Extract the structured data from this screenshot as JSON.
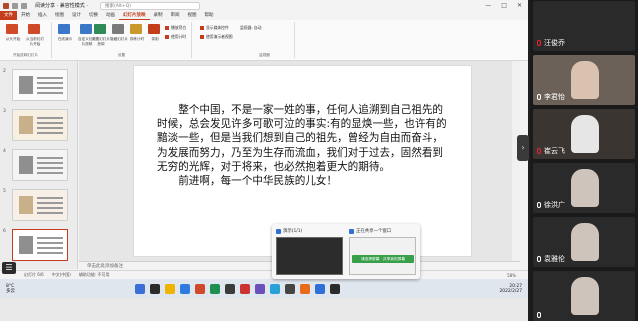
{
  "window": {
    "document_title": "阅读分享 · 兼容性模式 ·",
    "search_placeholder": "搜索(Alt+Q)",
    "window_controls": [
      "—",
      "□",
      "✕"
    ]
  },
  "tabs": [
    {
      "label": "文件",
      "active": false,
      "file": true
    },
    {
      "label": "开始",
      "active": false
    },
    {
      "label": "插入",
      "active": false
    },
    {
      "label": "绘图",
      "active": false
    },
    {
      "label": "设计",
      "active": false
    },
    {
      "label": "切换",
      "active": false
    },
    {
      "label": "动画",
      "active": false
    },
    {
      "label": "幻灯片放映",
      "active": true
    },
    {
      "label": "录制",
      "active": false
    },
    {
      "label": "审阅",
      "active": false
    },
    {
      "label": "视图",
      "active": false
    },
    {
      "label": "帮助",
      "active": false
    }
  ],
  "ribbon": {
    "buttons": [
      {
        "label": "从头开始",
        "color": "#d04a2a"
      },
      {
        "label": "从当前幻灯片开始",
        "color": "#d04a2a"
      },
      {
        "label": "在线演示",
        "color": "#3c78c8"
      },
      {
        "label": "自定义幻灯片放映",
        "color": "#3c78c8"
      },
      {
        "label": "设置幻灯片放映",
        "color": "#2f8a57"
      },
      {
        "label": "隐藏幻灯片",
        "color": "#7a7a7a"
      },
      {
        "label": "排练计时",
        "color": "#c99a2a"
      },
      {
        "label": "录制",
        "color": "#c43e1c"
      }
    ],
    "checks": [
      {
        "label": "播放旁白",
        "on": true
      },
      {
        "label": "使用计时",
        "on": true
      },
      {
        "label": "显示媒体控件",
        "on": true
      },
      {
        "label": "使用演示者视图",
        "on": true
      }
    ],
    "monitor_label": "监视器: 自动",
    "groups": [
      "开始放映幻灯片",
      "设置",
      "监视器"
    ]
  },
  "thumbnails": [
    {
      "num": "2",
      "color": "#fafafa"
    },
    {
      "num": "3",
      "color": "#f7efe2"
    },
    {
      "num": "4",
      "color": "#f4f4f4"
    },
    {
      "num": "5",
      "color": "#f8f0e6"
    },
    {
      "num": "6",
      "color": "#ffffff"
    }
  ],
  "slide": {
    "paragraph1": "整个中国，不是一家一姓的事，任何人追溯到自己祖先的时候，总会发见许多可歌可泣的事实:有的显焕一些，也许有的黯淡一些，但是当我们想到自己的祖先，曾经为自由而奋斗，为发展而努力，乃至为生存而流血，我们对于过去，固然看到无穷的光辉，对于将来，也必然抱着更大的期待。",
    "paragraph2": "前进啊，每一个中华民族的儿女！"
  },
  "notes_placeholder": "单击此处添加备注",
  "statusbar": {
    "left": "幻灯片 6/6",
    "lang": "中文(中国)",
    "accessibility": "辅助功能: 不可用",
    "zoom": "58%"
  },
  "taskbar": {
    "weather_temp": "8°C",
    "weather_desc": "多云",
    "time": "20:27",
    "date": "2022/2/27",
    "icons": [
      "#3a6fd8",
      "#2b2b2b",
      "#f0b400",
      "#2d7be0",
      "#d04a2a",
      "#1e8f4e",
      "#3b3b3b",
      "#cc3333",
      "#6b4fbb",
      "#2aa0d8",
      "#444444",
      "#e86a1a",
      "#2f6fd6",
      "#2b2b2b"
    ]
  },
  "popup": {
    "window1_title": "演示(1/1)",
    "window2_title": "正在共享一个窗口",
    "green_button": "请选择屏幕 · 共享我的屏幕"
  },
  "participants": [
    {
      "name": "汪俊乔",
      "mic_off": true,
      "bg": "#2a2a2a"
    },
    {
      "name": "李君怡",
      "mic_off": false,
      "bg": "#6b6158"
    },
    {
      "name": "崔云飞",
      "mic_off": true,
      "bg": "#3a3530"
    },
    {
      "name": "徐洪广",
      "mic_off": false,
      "bg": "#2a2a2a"
    },
    {
      "name": "袁雅伦",
      "mic_off": false,
      "bg": "#2a2a2a"
    },
    {
      "name": "",
      "mic_off": false,
      "bg": "#2a2a2a"
    }
  ],
  "collapse_label": "›",
  "left_menu_label": "☰"
}
